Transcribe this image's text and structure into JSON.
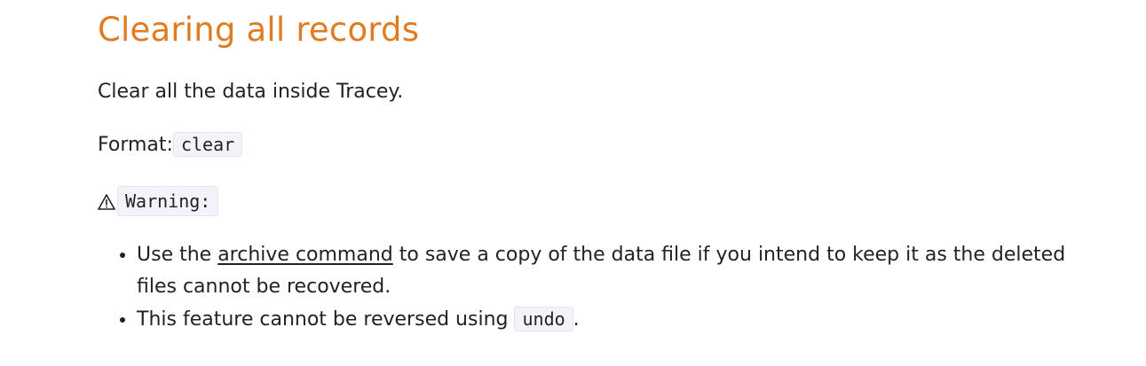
{
  "section": {
    "title": "Clearing all records",
    "description": "Clear all the data inside Tracey.",
    "format_label": "Format:",
    "format_code": "clear",
    "warning_label": "Warning:",
    "notes": [
      {
        "before": "Use the ",
        "link": "archive command",
        "after": " to save a copy of the data file if you intend to keep it as the deleted files cannot be recovered."
      },
      {
        "before": "This feature cannot be reversed using ",
        "code": "undo",
        "after": "."
      }
    ]
  },
  "icons": {
    "warning": "warning-triangle-icon"
  },
  "colors": {
    "title": "#e07b22",
    "text": "#222222",
    "code_bg": "#f3f3fb"
  }
}
